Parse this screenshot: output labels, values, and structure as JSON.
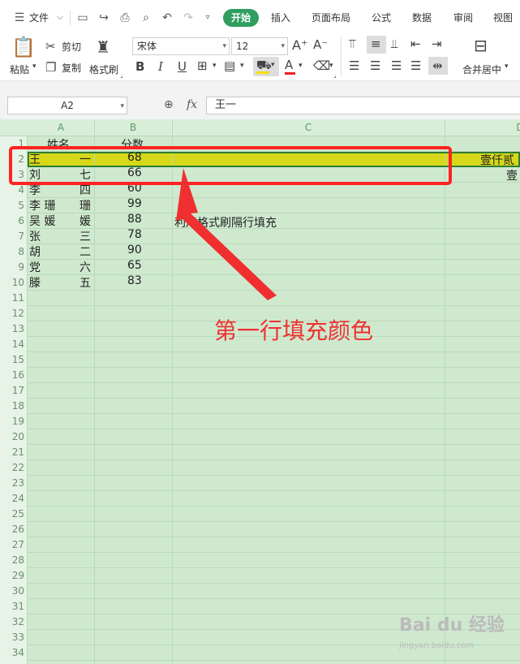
{
  "menubar": {
    "file_label": "文件",
    "tabs": [
      "开始",
      "插入",
      "页面布局",
      "公式",
      "数据",
      "审阅",
      "视图"
    ]
  },
  "ribbon": {
    "paste": "粘贴",
    "cut": "剪切",
    "copy": "复制",
    "format_painter": "格式刷",
    "font_name": "宋体",
    "font_size": "12",
    "merge_center": "合并居中"
  },
  "formula_bar": {
    "name_box": "A2",
    "fx_label": "fx",
    "formula": "王一"
  },
  "sheet": {
    "columns": [
      "A",
      "B",
      "C",
      "D"
    ],
    "row_numbers": [
      "1",
      "2",
      "3",
      "4",
      "5",
      "6",
      "7",
      "8",
      "9",
      "10",
      "11",
      "12",
      "13",
      "14",
      "15",
      "16",
      "17",
      "18",
      "19",
      "20",
      "21",
      "22",
      "23",
      "24",
      "25",
      "26",
      "27",
      "28",
      "29",
      "30",
      "31",
      "32",
      "33",
      "34"
    ],
    "header": {
      "name": "姓名",
      "score": "分数"
    },
    "rows": [
      {
        "first": "王",
        "last": "一",
        "score": "68"
      },
      {
        "first": "刘",
        "last": "七",
        "score": "66"
      },
      {
        "first": "李",
        "last": "四",
        "score": "60"
      },
      {
        "first": "李 珊",
        "last": "珊",
        "score": "99"
      },
      {
        "first": "吴 媛",
        "last": "媛",
        "score": "88"
      },
      {
        "first": "张",
        "last": "三",
        "score": "78"
      },
      {
        "first": "胡",
        "last": "二",
        "score": "90"
      },
      {
        "first": "党",
        "last": "六",
        "score": "65"
      },
      {
        "first": "滕",
        "last": "五",
        "score": "83"
      }
    ],
    "note_c6": "利用格式刷隔行填充",
    "d2": "壹仟贰",
    "d3": "壹"
  },
  "annotation": {
    "text": "第一行填充颜色",
    "color": "#f03030"
  },
  "watermark": {
    "logo": "Bai du 经验",
    "url": "jingyan.baidu.com"
  },
  "colors": {
    "accent": "#2f9e5f",
    "row_fill": "#d7d81a",
    "sheet_bg": "#cfe9cf"
  }
}
